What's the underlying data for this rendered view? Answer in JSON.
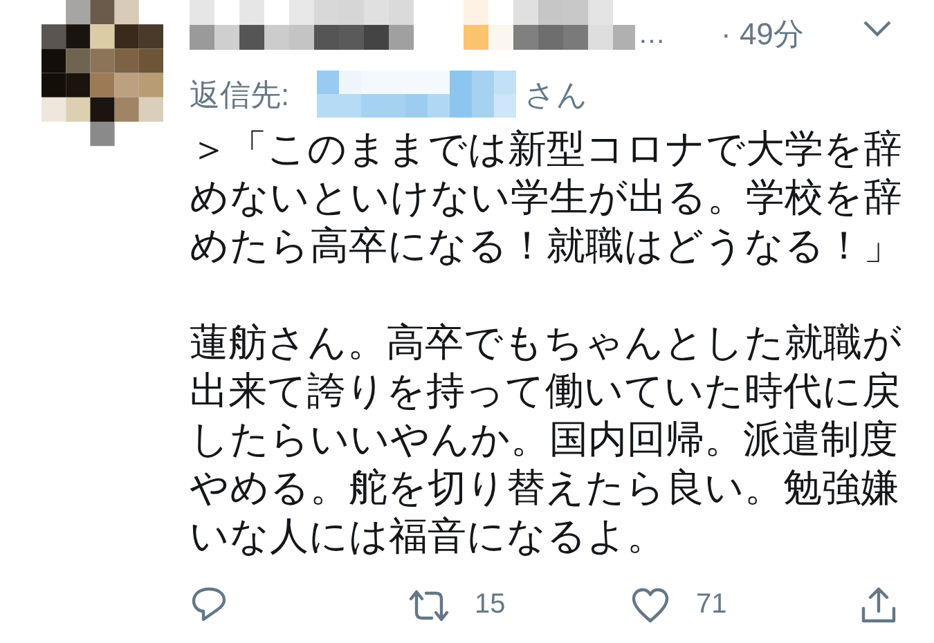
{
  "tweet": {
    "name_ellipsis": "…",
    "time": "· 49分",
    "reply_to": {
      "label": "返信先:",
      "suffix": "さん"
    },
    "paragraphs": [
      {
        "lines": [
          "＞「このままでは新型コロナで大学を辞",
          "めないといけない学生が出る。学校を辞",
          "めたら高卒になる！就職はどうなる！」"
        ]
      },
      {
        "lines": [
          "蓮舫さん。高卒でもちゃんとした就職が",
          "出来て誇りを持って働いていた時代に戻",
          "したらいいやんか。国内回帰。派遣制度",
          "やめる。舵を切り替えたら良い。勉強嫌",
          "いな人には福音になるよ。"
        ]
      }
    ],
    "actions": [
      {
        "kind": "reply"
      },
      {
        "kind": "retweet",
        "count": "15"
      },
      {
        "kind": "like",
        "count": "71"
      },
      {
        "kind": "share"
      }
    ]
  }
}
